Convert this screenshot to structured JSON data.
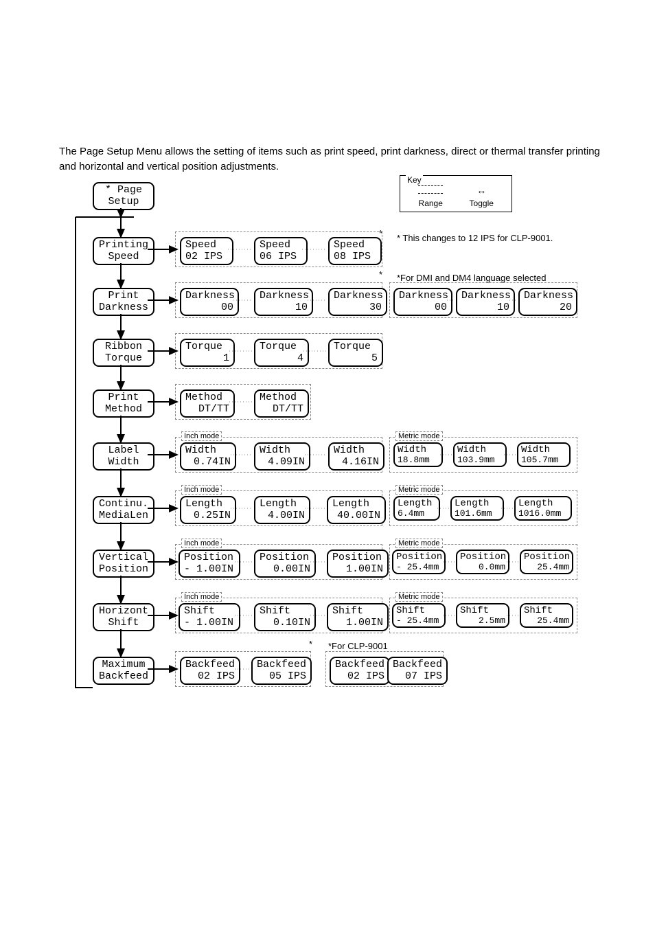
{
  "intro": "The Page Setup Menu allows the setting of items such as print speed, print darkness, direct or thermal transfer printing and horizontal and vertical position adjustments.",
  "key": {
    "title": "Key",
    "range": "Range",
    "toggle": "Toggle"
  },
  "root": {
    "l1": "* Page",
    "l2": "Setup"
  },
  "menu": {
    "speed": {
      "l1": "Printing",
      "l2": "Speed"
    },
    "dark": {
      "l1": "Print",
      "l2": "Darkness"
    },
    "torque": {
      "l1": "Ribbon",
      "l2": "Torque"
    },
    "method": {
      "l1": "Print",
      "l2": "Method"
    },
    "width": {
      "l1": "Label",
      "l2": "Width"
    },
    "len": {
      "l1": "Continu.",
      "l2": "MediaLen"
    },
    "vpos": {
      "l1": "Vertical",
      "l2": "Position"
    },
    "hshift": {
      "l1": "Horizont",
      "l2": "Shift"
    },
    "back": {
      "l1": "Maximum",
      "l2": "Backfeed"
    }
  },
  "notes": {
    "clp9001ips": "* This changes to 12 IPS for CLP-9001.",
    "dmi_dm4": "*For DMI and DM4 language selected",
    "clp9001": "*For CLP-9001"
  },
  "mode": {
    "inch": "Inch mode",
    "metric": "Metric mode"
  },
  "row_speed": [
    {
      "t": "Speed",
      "v": "02 IPS"
    },
    {
      "t": "Speed",
      "v": "06 IPS"
    },
    {
      "t": "Speed",
      "v": "08 IPS"
    }
  ],
  "row_dark": [
    {
      "t": "Darkness",
      "v": "00"
    },
    {
      "t": "Darkness",
      "v": "10"
    },
    {
      "t": "Darkness",
      "v": "30"
    }
  ],
  "row_dark_alt": [
    {
      "t": "Darkness",
      "v": "00"
    },
    {
      "t": "Darkness",
      "v": "10"
    },
    {
      "t": "Darkness",
      "v": "20"
    }
  ],
  "row_torque": [
    {
      "t": "Torque",
      "v": "1"
    },
    {
      "t": "Torque",
      "v": "4"
    },
    {
      "t": "Torque",
      "v": "5"
    }
  ],
  "row_method": [
    {
      "t": "Method",
      "v": "DT/TT"
    },
    {
      "t": "Method",
      "v": "DT/TT"
    }
  ],
  "row_width_in": [
    {
      "t": "Width",
      "v": "0.74IN"
    },
    {
      "t": "Width",
      "v": "4.09IN"
    },
    {
      "t": "Width",
      "v": "4.16IN"
    }
  ],
  "row_width_mm": [
    {
      "t": "Width",
      "v": "18.8mm"
    },
    {
      "t": "Width",
      "v": "103.9mm"
    },
    {
      "t": "Width",
      "v": "105.7mm"
    }
  ],
  "row_len_in": [
    {
      "t": "Length",
      "v": "0.25IN"
    },
    {
      "t": "Length",
      "v": "4.00IN"
    },
    {
      "t": "Length",
      "v": "40.00IN"
    }
  ],
  "row_len_mm": [
    {
      "t": "Length",
      "v": "6.4mm"
    },
    {
      "t": "Length",
      "v": "101.6mm"
    },
    {
      "t": "Length",
      "v": "1016.0mm"
    }
  ],
  "row_vpos_in": [
    {
      "t": "Position",
      "v": "- 1.00IN"
    },
    {
      "t": "Position",
      "v": "0.00IN"
    },
    {
      "t": "Position",
      "v": "1.00IN"
    }
  ],
  "row_vpos_mm": [
    {
      "t": "Position",
      "v": "- 25.4mm"
    },
    {
      "t": "Position",
      "v": "0.0mm"
    },
    {
      "t": "Position",
      "v": "25.4mm"
    }
  ],
  "row_hshift_in": [
    {
      "t": "Shift",
      "v": "- 1.00IN"
    },
    {
      "t": "Shift",
      "v": "0.10IN"
    },
    {
      "t": "Shift",
      "v": "1.00IN"
    }
  ],
  "row_hshift_mm": [
    {
      "t": "Shift",
      "v": "- 25.4mm"
    },
    {
      "t": "Shift",
      "v": "2.5mm"
    },
    {
      "t": "Shift",
      "v": "25.4mm"
    }
  ],
  "row_back": [
    {
      "t": "Backfeed",
      "v": "02 IPS"
    },
    {
      "t": "Backfeed",
      "v": "05 IPS"
    }
  ],
  "row_back_alt": [
    {
      "t": "Backfeed",
      "v": "02 IPS"
    },
    {
      "t": "Backfeed",
      "v": "07 IPS"
    }
  ]
}
